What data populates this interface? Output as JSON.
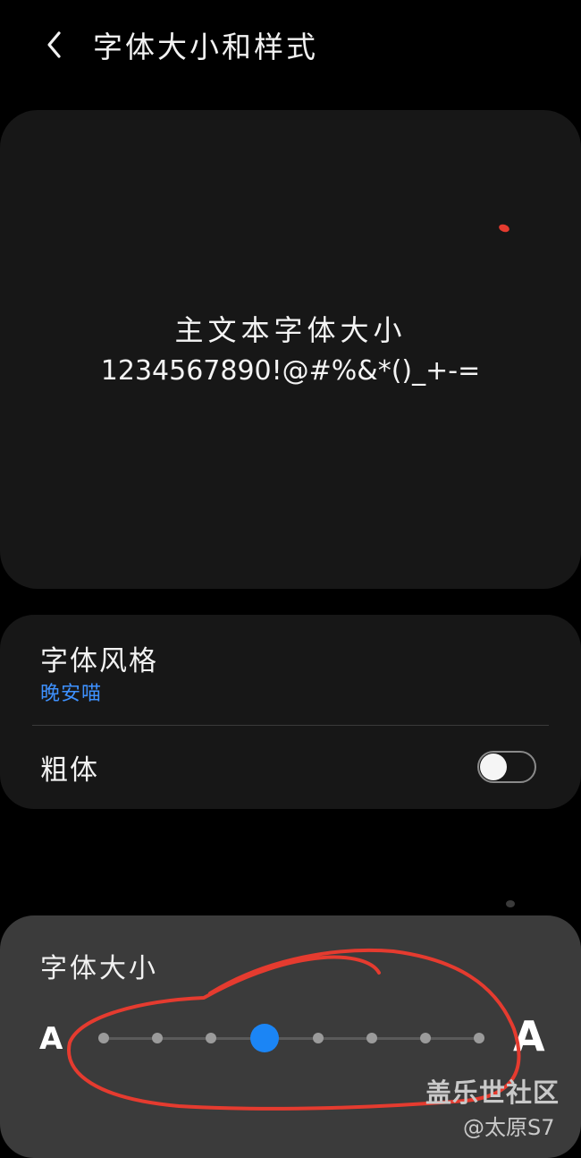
{
  "header": {
    "title": "字体大小和样式",
    "back_icon": "chevron-left-icon"
  },
  "preview": {
    "line1": "主文本字体大小",
    "line2": "1234567890!@#%&*()_+-="
  },
  "settings": {
    "font_style_label": "字体风格",
    "font_style_value": "晚安喵",
    "bold_label": "粗体",
    "bold_enabled": false
  },
  "font_size": {
    "label": "字体大小",
    "small_glyph": "A",
    "large_glyph": "A",
    "steps": 8,
    "selected_index": 3
  },
  "watermark": {
    "line1": "盖乐世社区",
    "line2": "@太原S7"
  },
  "colors": {
    "accent": "#1b85f5",
    "link": "#3e91ff",
    "annotation": "#e53b2f",
    "card": "#171717",
    "panel": "#3b3b3b"
  }
}
